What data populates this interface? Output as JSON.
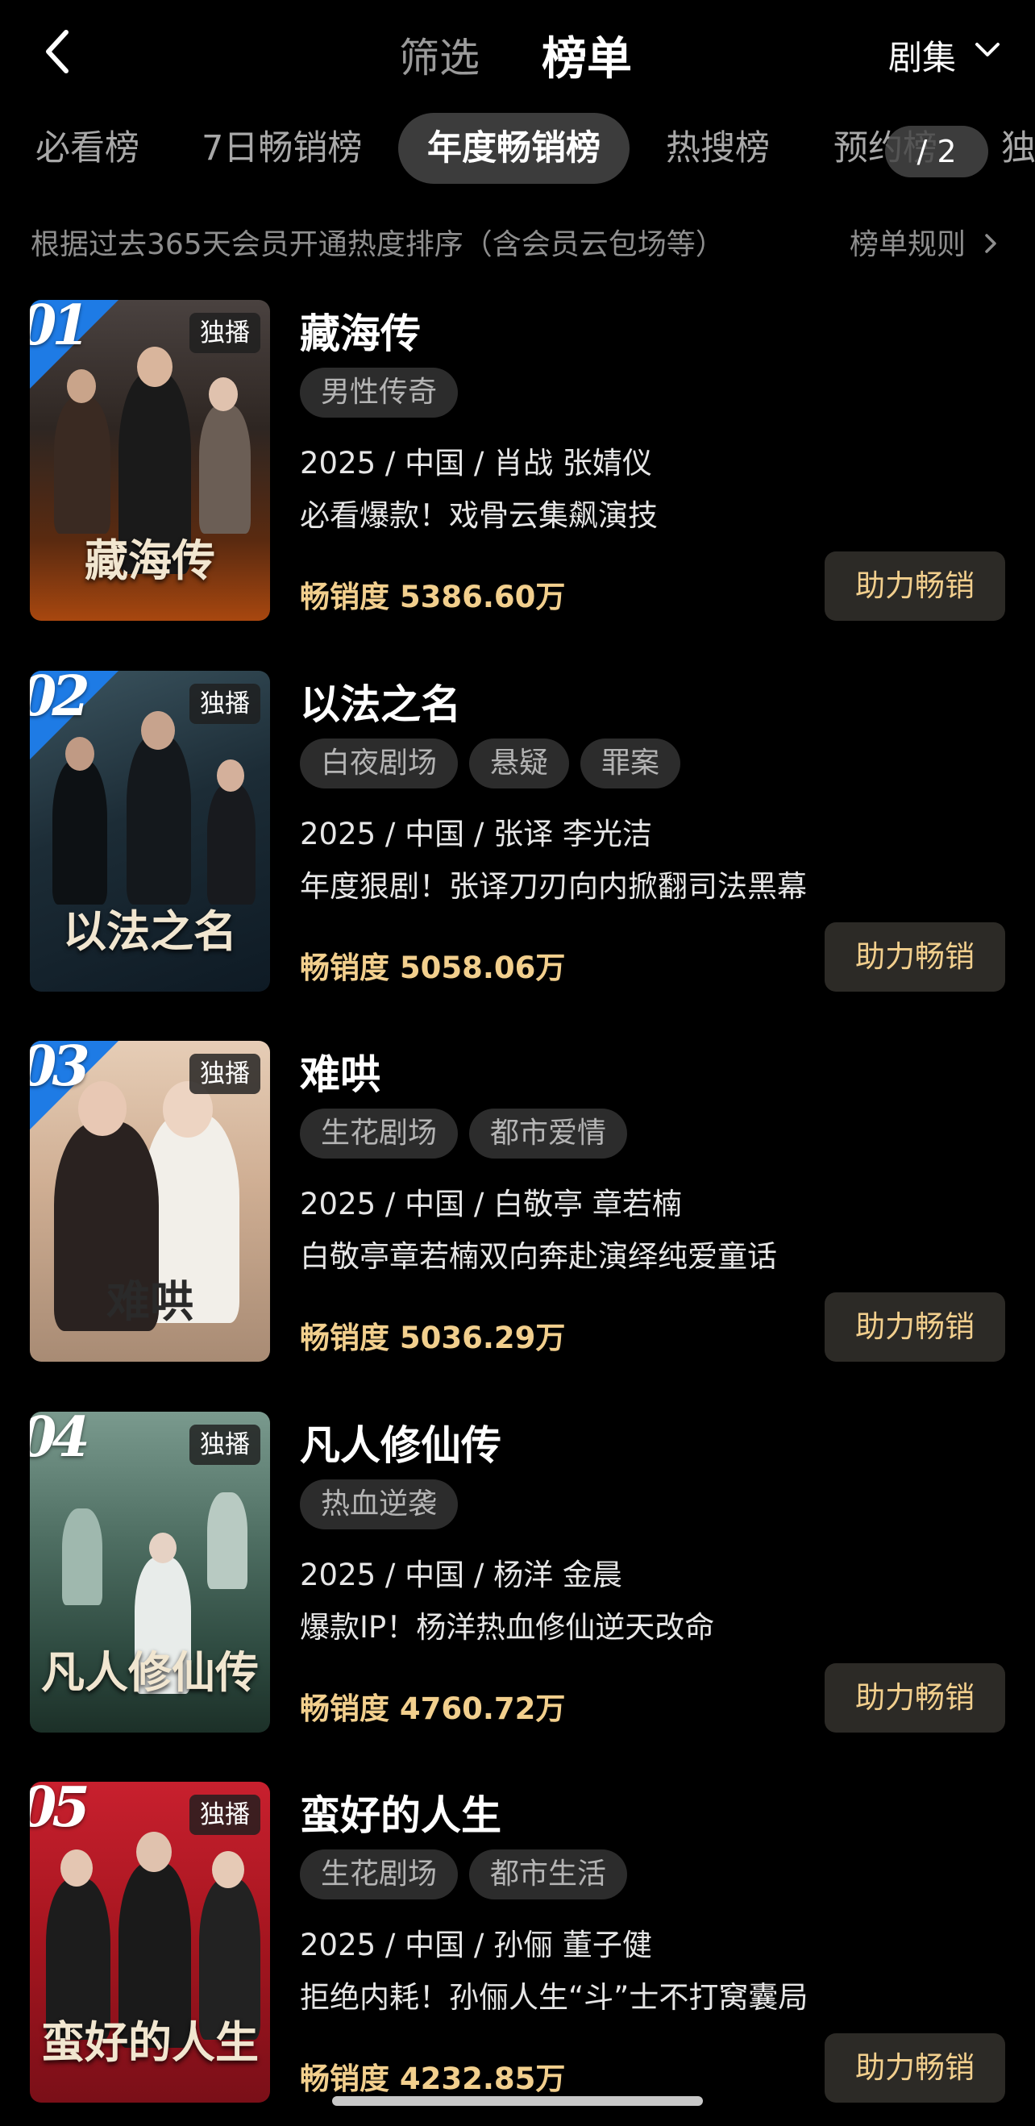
{
  "header": {
    "filter_label": "筛选",
    "rank_label": "榜单",
    "category": "剧集"
  },
  "tabs": [
    {
      "label": "必看榜"
    },
    {
      "label": "7日畅销榜"
    },
    {
      "label": "年度畅销榜"
    },
    {
      "label": "热搜榜"
    },
    {
      "label": "预约榜"
    },
    {
      "label": "独"
    }
  ],
  "page_indicator": "/ 2",
  "description": "根据过去365天会员开通热度排序（含会员云包场等）",
  "rules_label": "榜单规则",
  "boost_label": "助力畅销",
  "exclusive_label": "独播",
  "colors": {
    "accent_gold": "#f2cf8d",
    "rank_blue": "#1e7be5",
    "background": "#000000"
  },
  "items": [
    {
      "rank": "01",
      "title": "藏海传",
      "poster_title": "藏海传",
      "tags": [
        "男性传奇"
      ],
      "meta": "2025 / 中国 / 肖战 张婧仪",
      "blurb": "必看爆款！戏骨云集飙演技",
      "sales": "畅销度 5386.60万"
    },
    {
      "rank": "02",
      "title": "以法之名",
      "poster_title": "以法之名",
      "tags": [
        "白夜剧场",
        "悬疑",
        "罪案"
      ],
      "meta": "2025 / 中国 / 张译 李光洁",
      "blurb": "年度狠剧！张译刀刃向内掀翻司法黑幕",
      "sales": "畅销度 5058.06万"
    },
    {
      "rank": "03",
      "title": "难哄",
      "poster_title": "难哄",
      "tags": [
        "生花剧场",
        "都市爱情"
      ],
      "meta": "2025 / 中国 / 白敬亭 章若楠",
      "blurb": "白敬亭章若楠双向奔赴演绎纯爱童话",
      "sales": "畅销度 5036.29万"
    },
    {
      "rank": "04",
      "title": "凡人修仙传",
      "poster_title": "凡人修仙传",
      "tags": [
        "热血逆袭"
      ],
      "meta": "2025 / 中国 / 杨洋 金晨",
      "blurb": "爆款IP！杨洋热血修仙逆天改命",
      "sales": "畅销度 4760.72万"
    },
    {
      "rank": "05",
      "title": "蛮好的人生",
      "poster_title": "蛮好的人生",
      "tags": [
        "生花剧场",
        "都市生活"
      ],
      "meta": "2025 / 中国 / 孙俪 董子健",
      "blurb": "拒绝内耗！孙俪人生“斗”士不打窝囊局",
      "sales": "畅销度 4232.85万"
    }
  ]
}
